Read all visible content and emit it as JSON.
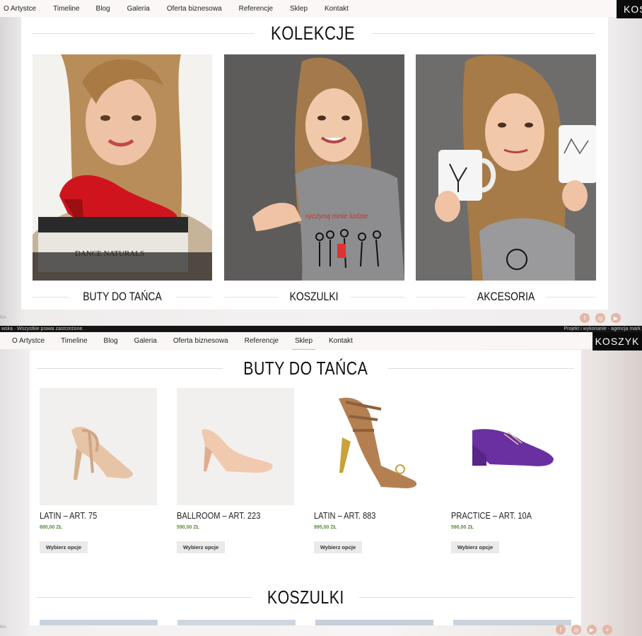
{
  "top": {
    "nav": [
      "O Artystce",
      "Timeline",
      "Blog",
      "Galeria",
      "Oferta biznesowa",
      "Referencje",
      "Sklep",
      "Kontakt"
    ],
    "active_nav": "Sklep",
    "cart_label": "KOS",
    "section_title": "KOLEKCJE",
    "collections": [
      {
        "label": "BUTY DO TAŃCA",
        "icon": "photo-red-shoe"
      },
      {
        "label": "KOSZULKI",
        "icon": "photo-tshirt"
      },
      {
        "label": "AKCESORIA",
        "icon": "photo-mugs"
      }
    ],
    "shoebox_brand": "DANCE NATURALS",
    "shirt_text": "ręczyną mnie ludzie",
    "footer_left": "wska · Wszystkie prawa zastrzeżone.",
    "footer_right": "Projekt i wykonanie - agencja mark",
    "left_edge_text": "RA"
  },
  "bottom": {
    "nav": [
      "O Artystce",
      "Timeline",
      "Blog",
      "Galeria",
      "Oferta biznesowa",
      "Referencje",
      "Sklep",
      "Kontakt"
    ],
    "active_nav": "Sklep",
    "cart_label": "KOSZYK",
    "section_title": "BUTY DO TAŃCA",
    "next_section_title": "KOSZULKI",
    "products": [
      {
        "name": "LATIN – ART. 75",
        "price": "680,00 ZŁ",
        "button": "Wybierz opcje",
        "icon": "beige-latin-sandal"
      },
      {
        "name": "BALLROOM – ART. 223",
        "price": "590,00 ZŁ",
        "button": "Wybierz opcje",
        "icon": "pink-ballroom-pump"
      },
      {
        "name": "LATIN – ART. 883",
        "price": "995,00 ZŁ",
        "button": "Wybierz opcje",
        "icon": "tan-latin-sandal"
      },
      {
        "name": "PRACTICE – ART. 10A",
        "price": "590,00 ZŁ",
        "button": "Wybierz opcje",
        "icon": "purple-practice-shoe"
      }
    ],
    "left_edge_text": "RA"
  },
  "colors": {
    "price": "#5a8a3c",
    "cart_bg": "#0b0b0b",
    "social": "#e4b7a7"
  },
  "social_icons": [
    "facebook-icon",
    "instagram-icon",
    "youtube-icon",
    "share-icon"
  ]
}
